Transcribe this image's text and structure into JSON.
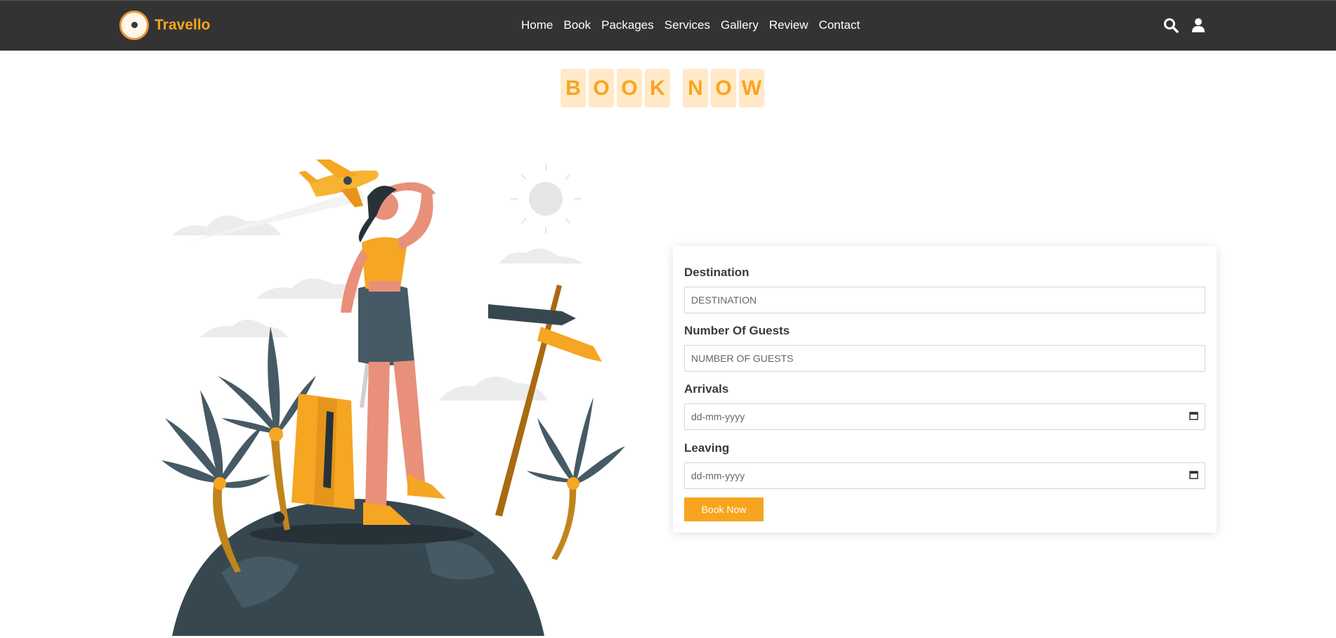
{
  "brand": {
    "name": "Travello",
    "mark_text": "Travello"
  },
  "nav": {
    "links": [
      "Home",
      "Book",
      "Packages",
      "Services",
      "Gallery",
      "Review",
      "Contact"
    ],
    "icons": [
      "search-icon",
      "user-icon"
    ]
  },
  "heading": {
    "words": [
      "BOOK",
      "NOW"
    ],
    "letters": [
      "B",
      "O",
      "O",
      "K",
      "N",
      "O",
      "W"
    ]
  },
  "form": {
    "destination": {
      "label": "Destination",
      "placeholder": "DESTINATION"
    },
    "guests": {
      "label": "Number Of Guests",
      "placeholder": "NUMBER OF GUESTS"
    },
    "arrivals": {
      "label": "Arrivals",
      "value": "dd-mm-yyyy"
    },
    "leaving": {
      "label": "Leaving",
      "value": "dd-mm-yyyy"
    },
    "submit_label": "Book Now"
  },
  "colors": {
    "accent": "#f7a51e",
    "navbar": "#333333",
    "heading_tile": "#ffe9c8",
    "globe": "#37474f",
    "skin": "#e8907a"
  }
}
